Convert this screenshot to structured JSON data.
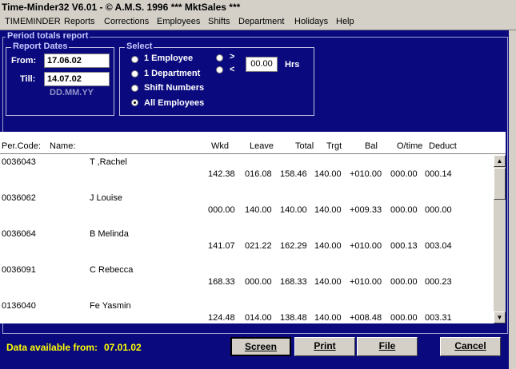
{
  "window": {
    "title": "Time-Minder32 V6.01 - © A.M.S. 1996   *** MktSales ***"
  },
  "menu": [
    "TIMEMINDER",
    "Reports",
    "Corrections",
    "Employees",
    "Shifts",
    "Department",
    "Holidays",
    "Help"
  ],
  "panel": {
    "title": "Period totals report"
  },
  "report_dates": {
    "title": "Report Dates",
    "from_label": "From:",
    "from_value": "17.06.02",
    "till_label": "Till:",
    "till_value": "14.07.02",
    "format_hint": "DD.MM.YY"
  },
  "select": {
    "title": "Select",
    "options": [
      {
        "label": "1 Employee",
        "selected": false
      },
      {
        "label": "1 Department",
        "selected": false
      },
      {
        "label": "Shift Numbers",
        "selected": false
      },
      {
        "label": "All Employees",
        "selected": true
      }
    ],
    "gt_label": ">",
    "lt_label": "<",
    "hours_value": "00.00",
    "hours_label": "Hrs"
  },
  "table": {
    "headers": [
      "Per.Code:",
      "Name:",
      "Wkd",
      "Leave",
      "Total",
      "Trgt",
      "Bal",
      "O/time",
      "Deduct"
    ],
    "rows": [
      {
        "code": "0036043",
        "name": "T    ,Rachel",
        "wkd": "142.38",
        "leave": "016.08",
        "total": "158.46",
        "trgt": "140.00",
        "bal": "+010.00",
        "otime": "000.00",
        "deduct": "000.14"
      },
      {
        "code": "0036062",
        "name": "J      Louise",
        "wkd": "000.00",
        "leave": "140.00",
        "total": "140.00",
        "trgt": "140.00",
        "bal": "+009.33",
        "otime": "000.00",
        "deduct": "000.00"
      },
      {
        "code": "0036064",
        "name": "B          Melinda",
        "wkd": "141.07",
        "leave": "021.22",
        "total": "162.29",
        "trgt": "140.00",
        "bal": "+010.00",
        "otime": "000.13",
        "deduct": "003.04"
      },
      {
        "code": "0036091",
        "name": "C     Rebecca",
        "wkd": "168.33",
        "leave": "000.00",
        "total": "168.33",
        "trgt": "140.00",
        "bal": "+010.00",
        "otime": "000.00",
        "deduct": "000.23"
      },
      {
        "code": "0136040",
        "name": "Fe          Yasmin",
        "wkd": "124.48",
        "leave": "014.00",
        "total": "138.48",
        "trgt": "140.00",
        "bal": "+008.48",
        "otime": "000.00",
        "deduct": "003.31"
      }
    ]
  },
  "footer": {
    "data_label": "Data available from:",
    "data_date": "07.01.02"
  },
  "buttons": {
    "screen": "Screen",
    "print": "Print",
    "file": "File",
    "cancel": "Cancel"
  },
  "colors": {
    "panel_bg": "#0a0a7e",
    "footer_text": "#ffff00",
    "group_title": "#c8c8ff"
  }
}
